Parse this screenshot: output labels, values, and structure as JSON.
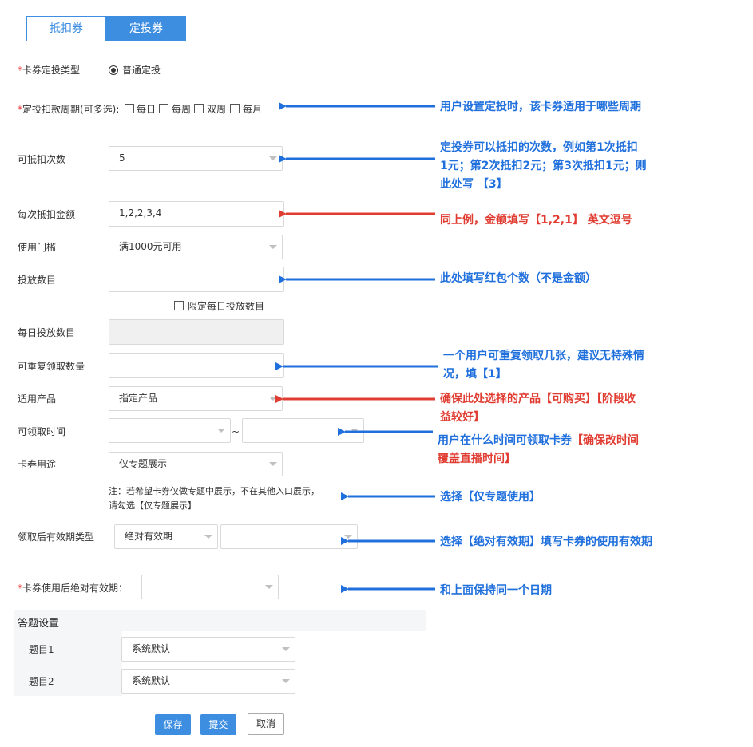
{
  "tabs": [
    {
      "label": "抵扣券",
      "active": false
    },
    {
      "label": "定投券",
      "active": true
    }
  ],
  "form": {
    "card_type": {
      "label": "卡券定投类型",
      "option": "普通定投"
    },
    "period": {
      "label": "定投扣款周期(可多选):",
      "options": [
        "每日",
        "每周",
        "双周",
        "每月"
      ]
    },
    "deduct_times": {
      "label": "可抵扣次数",
      "value": "5"
    },
    "amount_each": {
      "label": "每次抵扣金额",
      "value": "1,2,2,3,4"
    },
    "threshold": {
      "label": "使用门槛",
      "value": "满1000元可用"
    },
    "issue_count": {
      "label": "投放数目",
      "value": ""
    },
    "limit_daily": {
      "label": "限定每日投放数目"
    },
    "daily_count": {
      "label": "每日投放数目"
    },
    "repeat_count": {
      "label": "可重复领取数量",
      "value": ""
    },
    "products": {
      "label": "适用产品",
      "value": "指定产品"
    },
    "claim_time": {
      "label": "可领取时间",
      "separator": "~"
    },
    "usage": {
      "label": "卡券用途",
      "value": "仅专题展示"
    },
    "usage_note_1": "注：若希望卡券仅做专题中展示，不在其他入口展示，",
    "usage_note_2": "请勾选【仅专题展示】",
    "validity_type": {
      "label": "领取后有效期类型",
      "value": "绝对有效期"
    },
    "absolute_validity": {
      "label": "卡券使用后绝对有效期："
    }
  },
  "quiz": {
    "title": "答题设置",
    "items": [
      {
        "label": "题目1",
        "value": "系统默认"
      },
      {
        "label": "题目2",
        "value": "系统默认"
      }
    ]
  },
  "buttons": {
    "save": "保存",
    "submit": "提交",
    "cancel": "取消"
  },
  "annotations": {
    "period": "用户设置定投时，该卡券适用于哪些周期",
    "times_1": "定投券可以抵扣的次数，例如第1次抵扣",
    "times_2": "1元；第2次抵扣2元；第3次抵扣1元；则",
    "times_3": "此处写 【3】",
    "amount": "同上例，金额填写【1,2,1】 英文逗号",
    "issue": "此处填写红包个数（不是金额）",
    "repeat_1": "一个用户可重复领取几张，建议无特殊情",
    "repeat_2": "况，填【1】",
    "product_1": "确保此处选择的产品【可购买】【阶段收",
    "product_2": "益较好】",
    "time_1a": "用户在什么时间可领取卡券",
    "time_1b": "【确保改时间",
    "time_2": "覆盖直播时间】",
    "usage": "选择【仅专题使用】",
    "validity": "选择【绝对有效期】填写卡券的使用有效期",
    "same_date": "和上面保持同一个日期"
  },
  "colors": {
    "primary": "#3d8ee0",
    "annotation_blue": "#1f6fdc",
    "annotation_red": "#e03c31",
    "required": "#e53935"
  }
}
